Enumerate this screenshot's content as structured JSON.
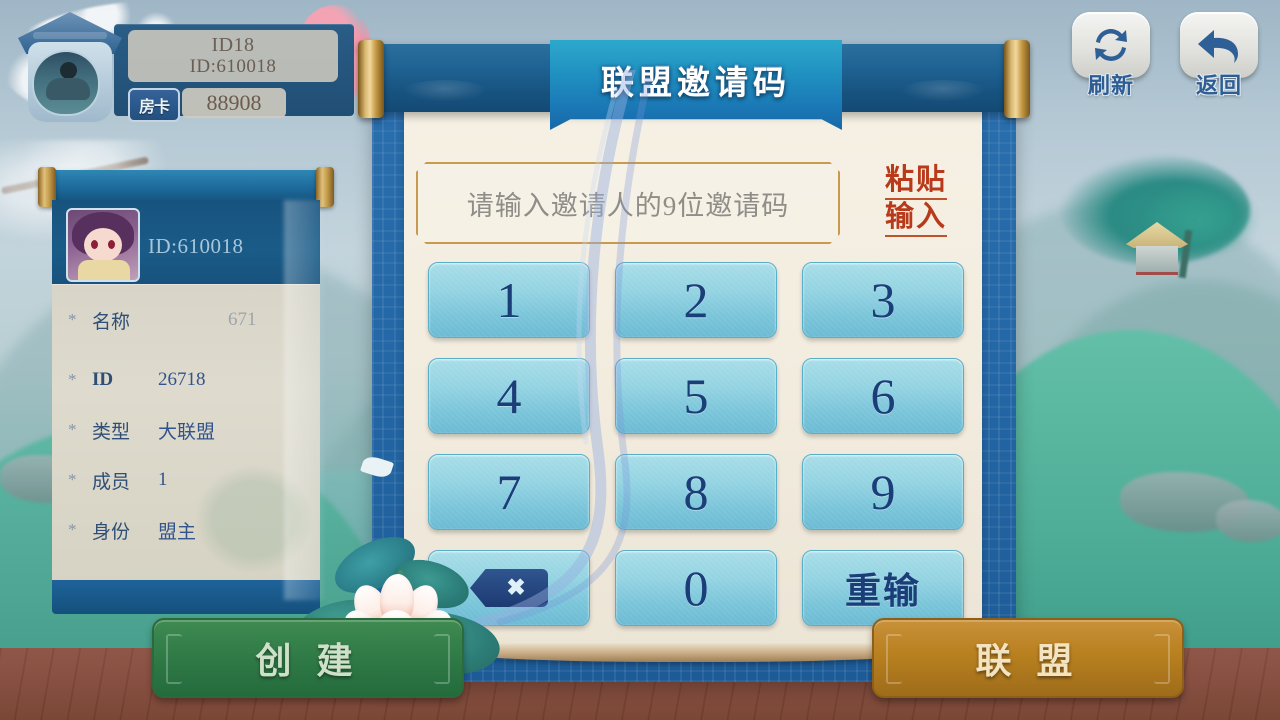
{
  "player": {
    "name": "ID18",
    "id_label": "ID:610018",
    "card_icon_label": "房卡",
    "card_count": "88908"
  },
  "alliance": {
    "header_id": "ID:610018",
    "rows": [
      {
        "star": "*",
        "key": "名称",
        "value": "671"
      },
      {
        "star": "*",
        "key": "ID",
        "value": "26718"
      },
      {
        "star": "*",
        "key": "类型",
        "value": "大联盟"
      },
      {
        "star": "*",
        "key": "成员",
        "value": "1"
      },
      {
        "star": "*",
        "key": "身份",
        "value": "盟主"
      }
    ]
  },
  "topbar": {
    "refresh_label": "刷新",
    "back_label": "返回",
    "refresh_icon": "refresh-icon",
    "back_icon": "back-arrow-icon"
  },
  "panel": {
    "title": "联盟邀请码",
    "input_placeholder": "请输入邀请人的9位邀请码",
    "input_value": "",
    "paste_line1": "粘贴",
    "paste_line2": "输入"
  },
  "keypad": {
    "keys": [
      {
        "label": "1",
        "name": "key-1",
        "type": "num"
      },
      {
        "label": "2",
        "name": "key-2",
        "type": "num"
      },
      {
        "label": "3",
        "name": "key-3",
        "type": "num"
      },
      {
        "label": "4",
        "name": "key-4",
        "type": "num"
      },
      {
        "label": "5",
        "name": "key-5",
        "type": "num"
      },
      {
        "label": "6",
        "name": "key-6",
        "type": "num"
      },
      {
        "label": "7",
        "name": "key-7",
        "type": "num"
      },
      {
        "label": "8",
        "name": "key-8",
        "type": "num"
      },
      {
        "label": "9",
        "name": "key-9",
        "type": "num"
      },
      {
        "label": "",
        "name": "key-backspace",
        "type": "backspace"
      },
      {
        "label": "0",
        "name": "key-0",
        "type": "num"
      },
      {
        "label": "重输",
        "name": "key-reset",
        "type": "cn"
      }
    ]
  },
  "footer": {
    "create_label": "创 建",
    "join_label": "联 盟"
  },
  "colors": {
    "panel_frame_blue": "#2467a6",
    "paper_cream": "#f3ede0",
    "key_blue": "#93d3e2",
    "key_text": "#1b3d78",
    "paste_red": "#b83a1a",
    "gold_border": "#c79a4e",
    "create_green": "#2f7a46",
    "join_orange": "#b8801f",
    "floor_brown": "#82493b"
  }
}
